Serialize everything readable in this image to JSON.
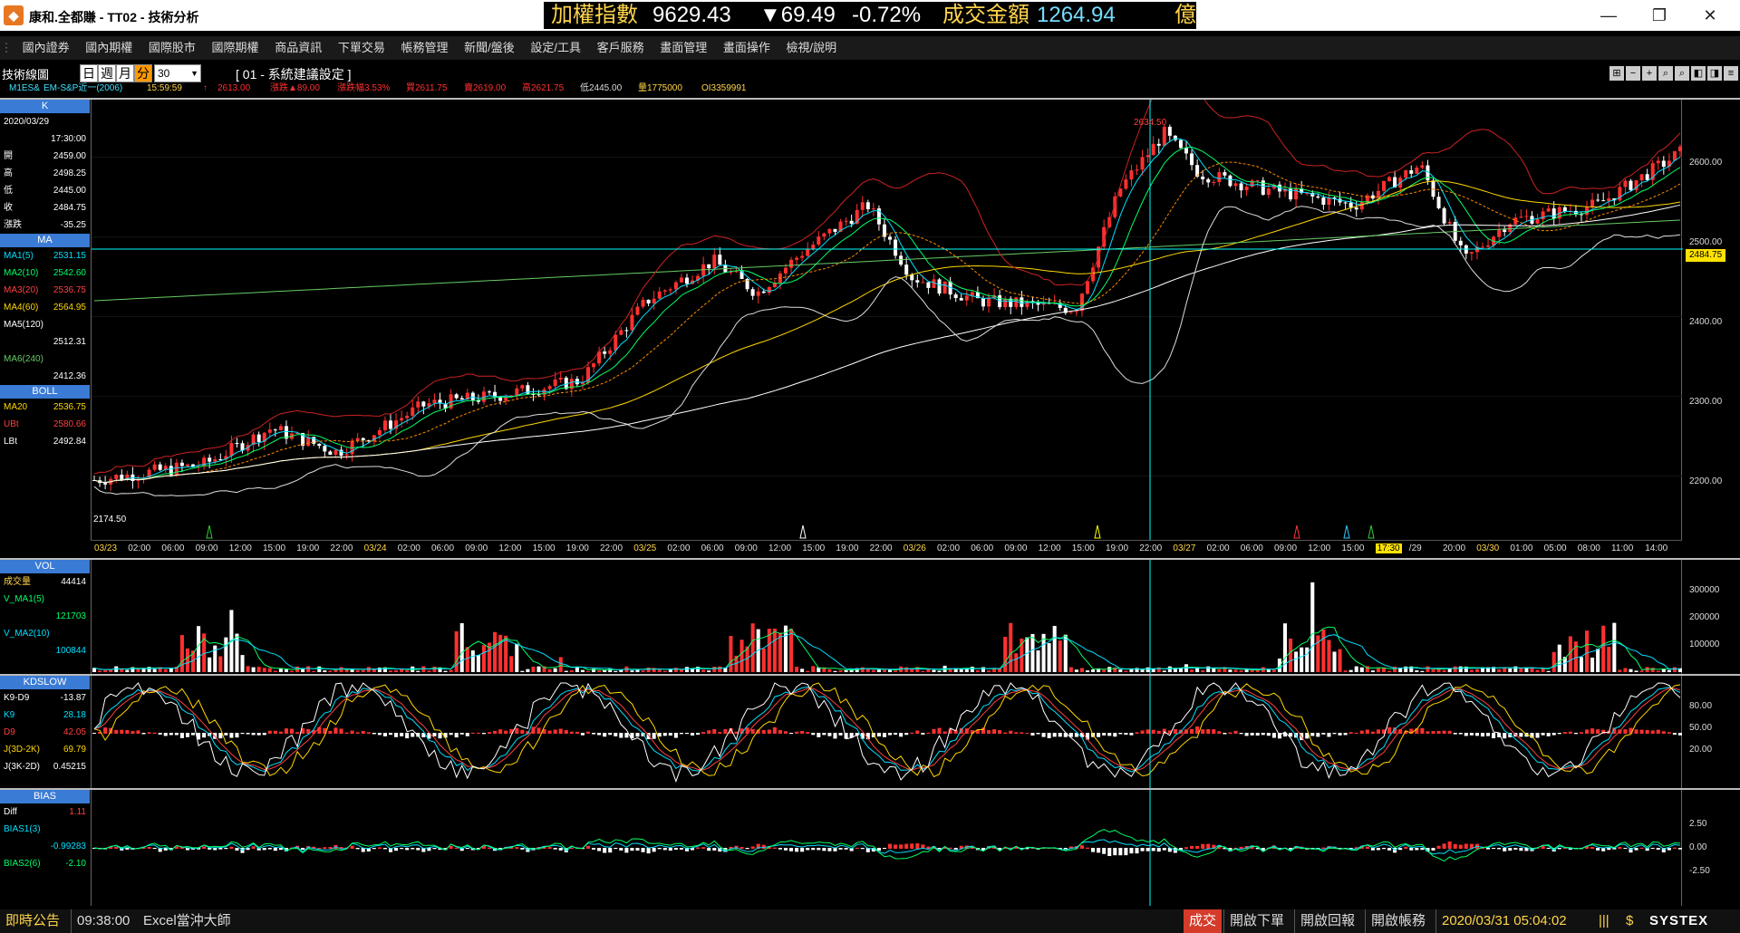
{
  "window": {
    "icon_glyph": "◆",
    "title": "康和.全都賺 - TT02 - 技術分析",
    "min_glyph": "—",
    "max_glyph": "❐",
    "close_glyph": "✕"
  },
  "ticker": {
    "label": "加權指數",
    "value": "9629.43",
    "change": "▼69.49",
    "pct": "-0.72%",
    "amount_label": "成交金額",
    "amount": "1264.94",
    "unit": "億"
  },
  "menu": [
    "國內證券",
    "國內期權",
    "國際股市",
    "國際期權",
    "商品資訊",
    "下單交易",
    "帳務管理",
    "新聞/盤後",
    "設定/工具",
    "客戶服務",
    "畫面管理",
    "畫面操作",
    "檢視/說明"
  ],
  "toolbar": {
    "title": "技術線圖",
    "timeframes": [
      "日",
      "週",
      "月",
      "分"
    ],
    "active_timeframe": "分",
    "period": "30",
    "setting": "[ 01 - 系統建議設定 ]",
    "tools": [
      "⊞",
      "−",
      "+",
      "⌕",
      "⌕",
      "◧",
      "◨",
      "≡"
    ]
  },
  "quote": {
    "symbol": "M1ES&",
    "name": "EM-S&P近一(2006)",
    "time": "15:59:59",
    "arrow": "↑",
    "last": "2613.00",
    "change": "漲跌▲89.00",
    "pct": "漲跌幅3.53%",
    "bid": "買2611.75",
    "ask": "賣2619.00",
    "high": "高2621.75",
    "low": "低2445.00",
    "volume": "量1775000",
    "oi": "OI3359991"
  },
  "colors": {
    "up": "#ff3030",
    "down": "#ffffff",
    "ma5": "#00e0ff",
    "ma10": "#00ff66",
    "ma20": "#ff4040",
    "ma60": "#ffd700",
    "ma120": "#ffffff",
    "ma240": "#66cc66",
    "cursor": "#00ffff"
  },
  "legend": {
    "k_head": "K",
    "date": "2020/03/29",
    "time": "17:30:00",
    "open_l": "開",
    "open": "2459.00",
    "high_l": "高",
    "high": "2498.25",
    "low_l": "低",
    "low": "2445.00",
    "close_l": "收",
    "close": "2484.75",
    "chg_l": "漲跌",
    "chg": "-35.25",
    "ma_head": "MA",
    "ma1_l": "MA1(5)",
    "ma1": "2531.15",
    "ma2_l": "MA2(10)",
    "ma2": "2542.60",
    "ma3_l": "MA3(20)",
    "ma3": "2536.75",
    "ma4_l": "MA4(60)",
    "ma4": "2564.95",
    "ma5_l": "MA5(120)",
    "ma5": "2512.31",
    "ma6_l": "MA6(240)",
    "ma6": "2412.36",
    "boll_head": "BOLL",
    "b_ma_l": "MA20",
    "b_ma": "2536.75",
    "b_ub_l": "UBt",
    "b_ub": "2580.66",
    "b_lb_l": "LBt",
    "b_lb": "2492.84"
  },
  "main_chart": {
    "y_ticks": [
      "2600.00",
      "2500.00",
      "2400.00",
      "2300.00",
      "2200.00"
    ],
    "current_price": "2484.75",
    "high_mark": "2634.50",
    "low_mark": "2174.50"
  },
  "x_axis": [
    {
      "t": "03/23",
      "day": true
    },
    {
      "t": "02:00"
    },
    {
      "t": "06:00"
    },
    {
      "t": "09:00"
    },
    {
      "t": "12:00"
    },
    {
      "t": "15:00"
    },
    {
      "t": "19:00"
    },
    {
      "t": "22:00"
    },
    {
      "t": "03/24",
      "day": true
    },
    {
      "t": "02:00"
    },
    {
      "t": "06:00"
    },
    {
      "t": "09:00"
    },
    {
      "t": "12:00"
    },
    {
      "t": "15:00"
    },
    {
      "t": "19:00"
    },
    {
      "t": "22:00"
    },
    {
      "t": "03/25",
      "day": true
    },
    {
      "t": "02:00"
    },
    {
      "t": "06:00"
    },
    {
      "t": "09:00"
    },
    {
      "t": "12:00"
    },
    {
      "t": "15:00"
    },
    {
      "t": "19:00"
    },
    {
      "t": "22:00"
    },
    {
      "t": "03/26",
      "day": true
    },
    {
      "t": "02:00"
    },
    {
      "t": "06:00"
    },
    {
      "t": "09:00"
    },
    {
      "t": "12:00"
    },
    {
      "t": "15:00"
    },
    {
      "t": "19:00"
    },
    {
      "t": "22:00"
    },
    {
      "t": "03/27",
      "day": true
    },
    {
      "t": "02:00"
    },
    {
      "t": "06:00"
    },
    {
      "t": "09:00"
    },
    {
      "t": "12:00"
    },
    {
      "t": "15:00"
    },
    {
      "t": "17:30",
      "cursor": true
    },
    {
      "t": "/29"
    },
    {
      "t": "20:00"
    },
    {
      "t": "03/30",
      "day": true
    },
    {
      "t": "01:00"
    },
    {
      "t": "05:00"
    },
    {
      "t": "08:00"
    },
    {
      "t": "11:00"
    },
    {
      "t": "14:00"
    }
  ],
  "vol": {
    "head": "VOL",
    "a_l": "成交量",
    "a": "44414",
    "b_l": "V_MA1(5)",
    "b": "121703",
    "c_l": "V_MA2(10)",
    "c": "100844",
    "y_ticks": [
      "300000",
      "200000",
      "100000"
    ]
  },
  "kd": {
    "head": "KDSLOW",
    "a_l": "K9-D9",
    "a": "-13.87",
    "b_l": "K9",
    "b": "28.18",
    "c_l": "D9",
    "c": "42.05",
    "d_l": "J(3D-2K)",
    "d": "69.79",
    "e_l": "J(3K-2D)",
    "e": "0.45215",
    "y_ticks": [
      "80.00",
      "50.00",
      "20.00"
    ]
  },
  "bias": {
    "head": "BIAS",
    "a_l": "Diff",
    "a": "1.11",
    "b_l": "BIAS1(3)",
    "b": "-0.99283",
    "c_l": "BIAS2(6)",
    "c": "-2.10",
    "y_ticks": [
      "2.50",
      "0.00",
      "-2.50"
    ]
  },
  "status": {
    "announce": "即時公告",
    "time": "09:38:00",
    "news": "Excel當沖大師",
    "trade": "成交",
    "b1": "開啟下單",
    "b2": "開啟回報",
    "b3": "開啟帳務",
    "clock": "2020/03/31 05:04:02",
    "sep": "|||",
    "dollar": "$",
    "brand": "SYSTEX"
  }
}
